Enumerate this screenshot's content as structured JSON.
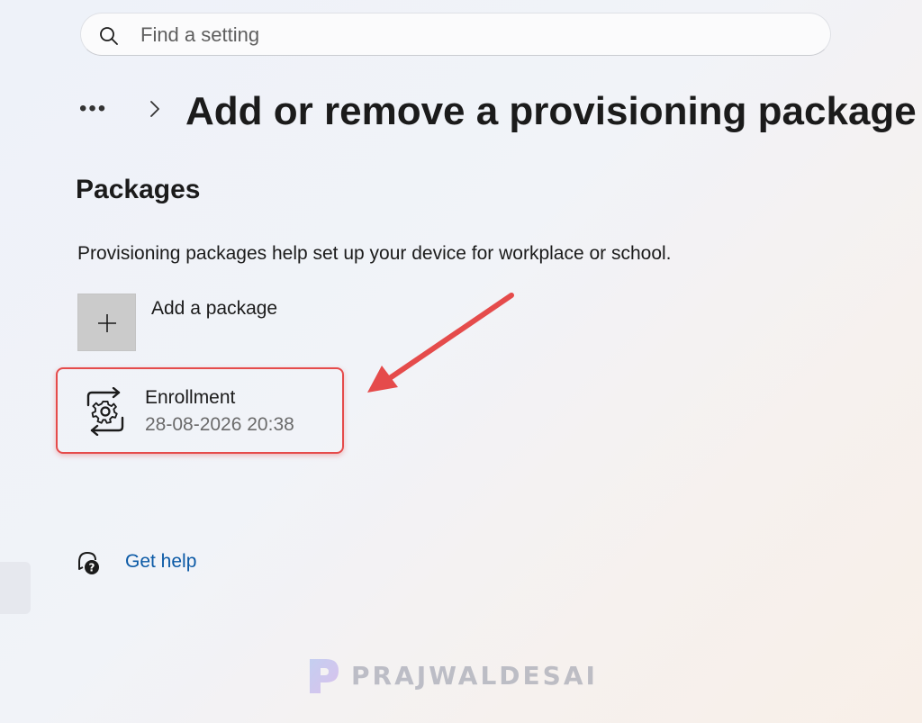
{
  "search": {
    "placeholder": "Find a setting",
    "icon": "search-icon"
  },
  "breadcrumb": {
    "more_label": "•••",
    "separator_icon": "chevron-right-icon",
    "title": "Add or remove a provisioning package"
  },
  "packages_section": {
    "title": "Packages",
    "description": "Provisioning packages help set up your device for workplace or school.",
    "add_button": {
      "label": "Add a package",
      "icon": "plus-icon"
    },
    "items": [
      {
        "name": "Enrollment",
        "date": "28-08-2026 20:38",
        "icon": "provisioning-package-icon"
      }
    ]
  },
  "help": {
    "label": "Get help",
    "icon": "help-icon"
  },
  "annotation": {
    "highlight_color": "#e54b4b",
    "arrow_color": "#e54b4b"
  },
  "watermark": {
    "text": "PRAJWALDESAI",
    "logo_letter": "P"
  },
  "colors": {
    "link": "#0c5aa6",
    "accent_tile": "#cbcbcb"
  }
}
